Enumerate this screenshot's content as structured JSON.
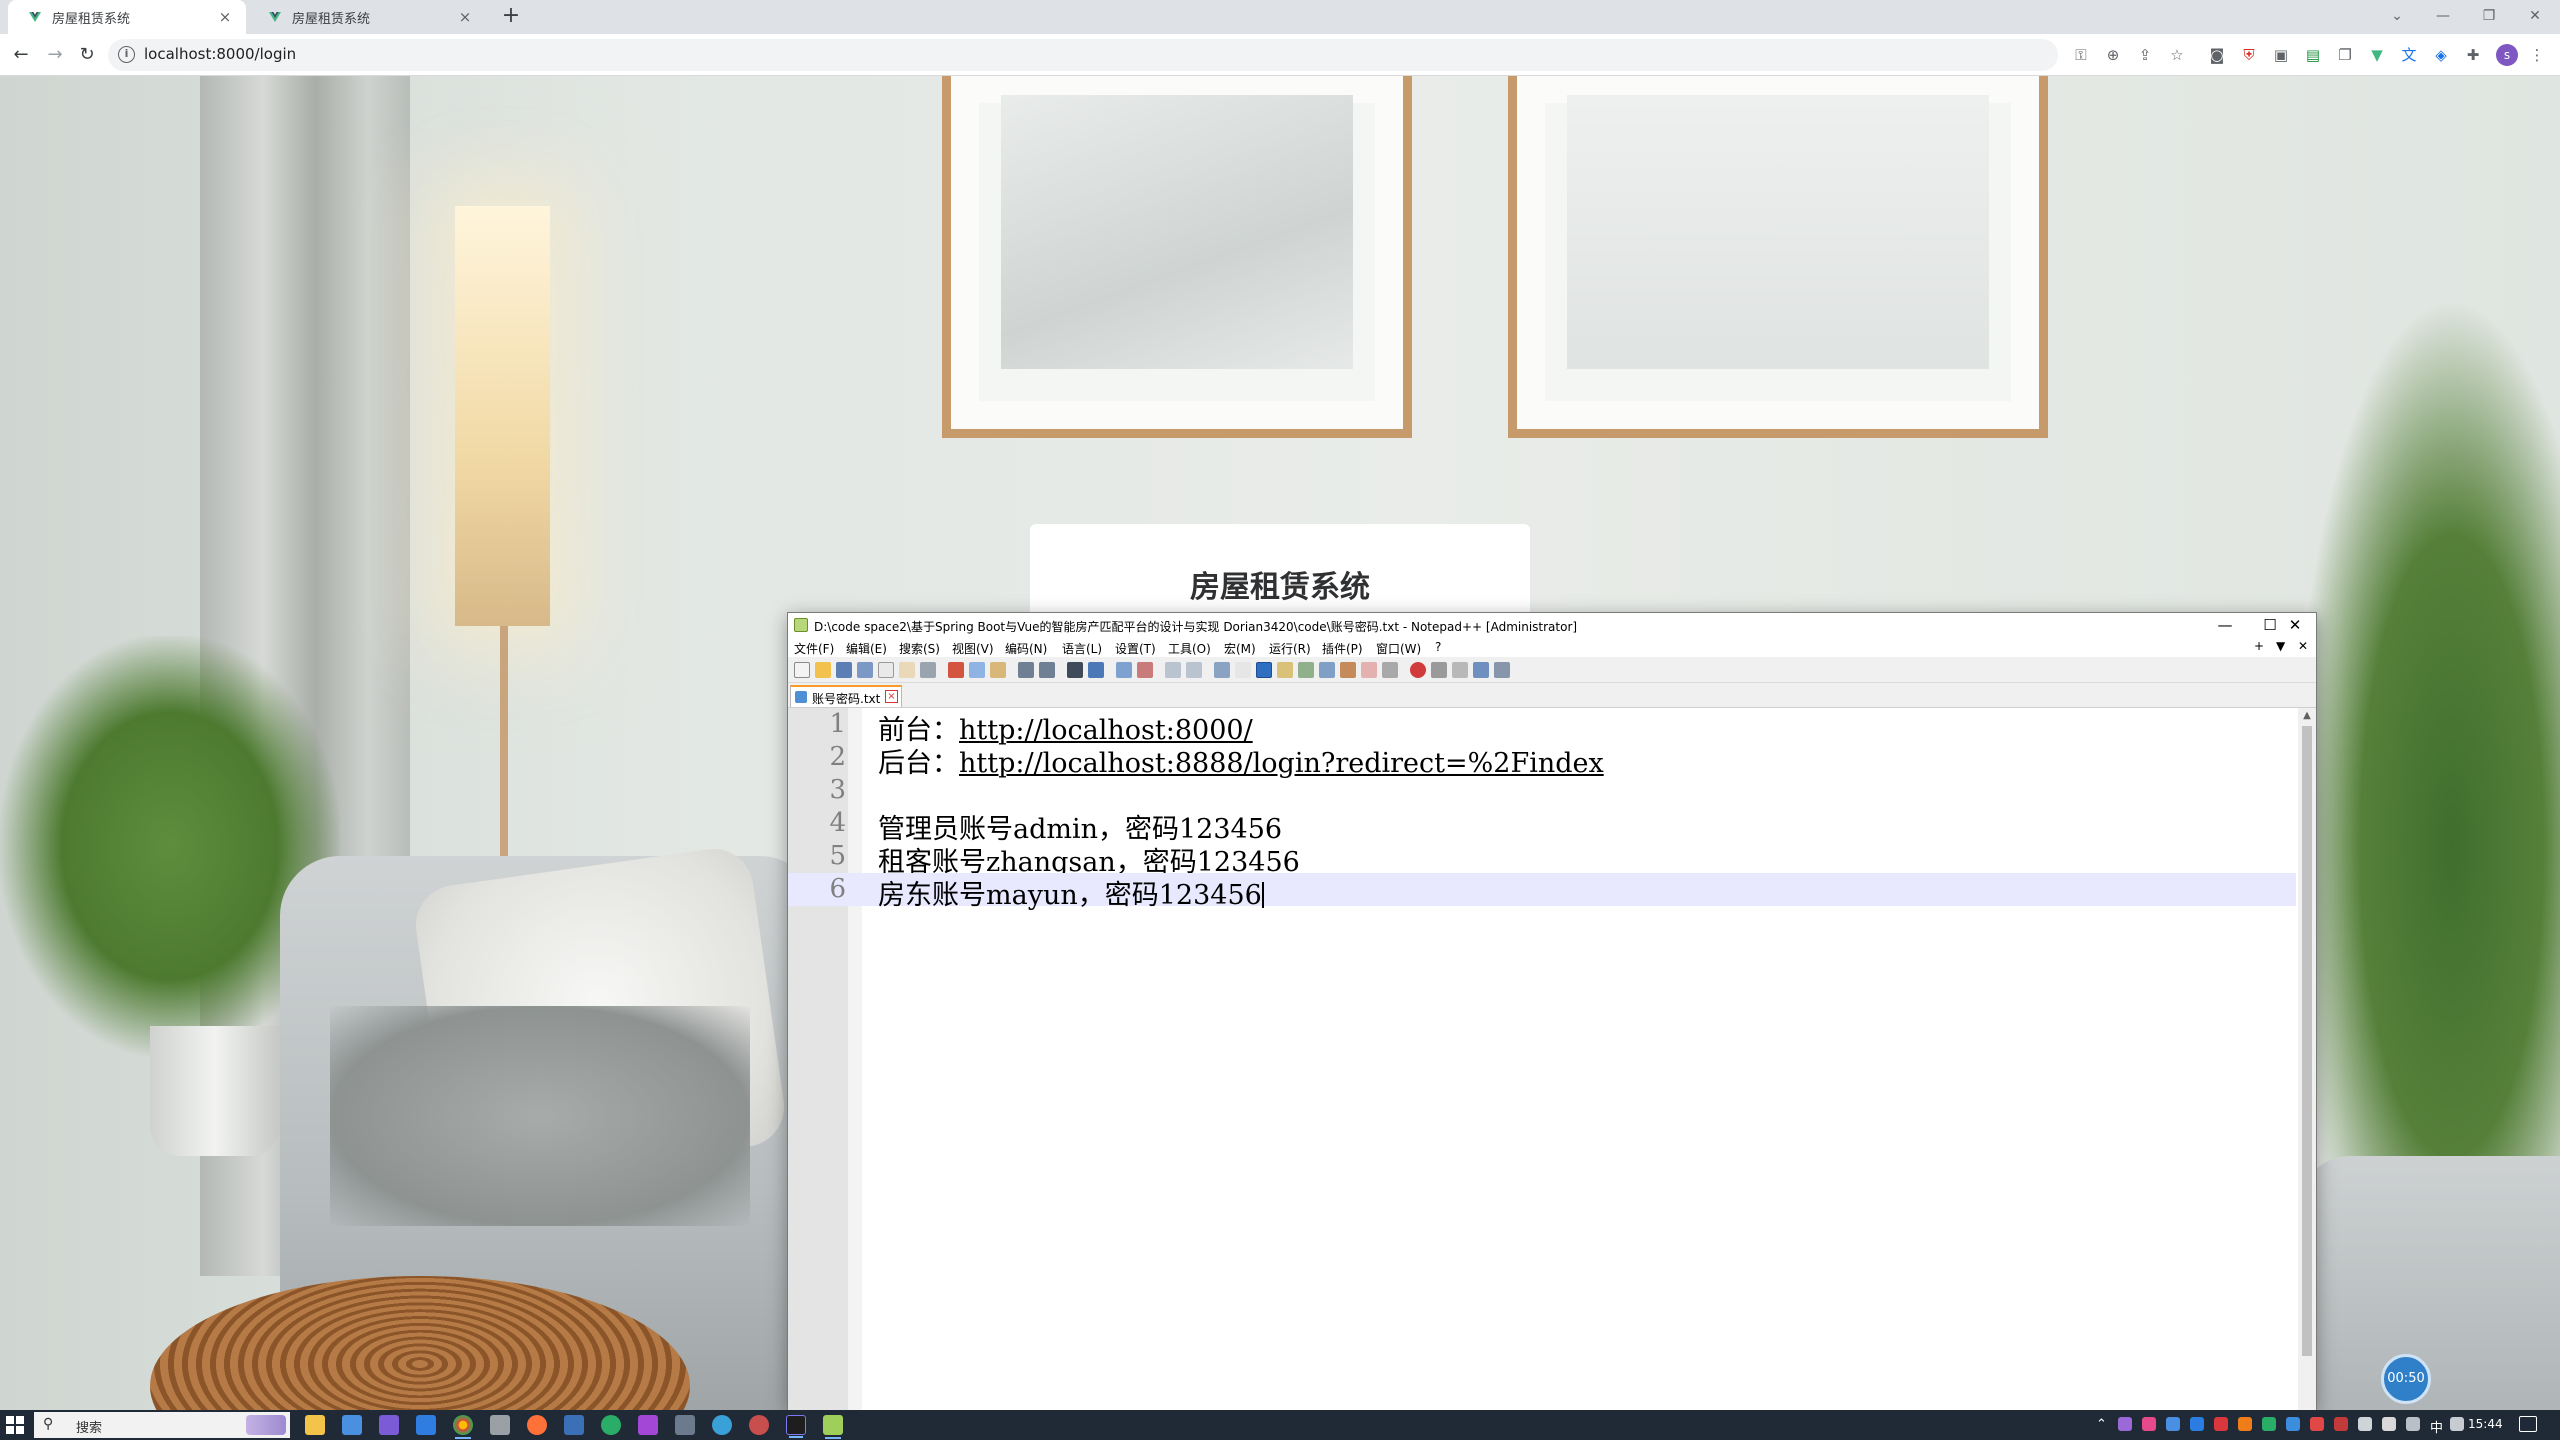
{
  "browser": {
    "tabs": [
      {
        "label": "房屋租赁系统",
        "close": "×"
      },
      {
        "label": "房屋租赁系统",
        "close": "×"
      }
    ],
    "new_tab": "+",
    "window_controls": {
      "chevron": "⌄",
      "minimize": "—",
      "restore": "❐",
      "close": "✕"
    },
    "nav": {
      "back": "←",
      "forward": "→",
      "reload": "↻"
    },
    "url": "localhost:8000/login",
    "info_icon_glyph": "i",
    "toolbar_icons": [
      "key-icon",
      "zoom-icon",
      "share-icon",
      "star-icon",
      "camera-icon",
      "shield-icon",
      "extension-icon",
      "clipboard-icon",
      "vue-devtools-icon",
      "translate-icon",
      "puzzle-icon",
      "download-icon",
      "sidepanel-icon"
    ],
    "profile_initial": "s",
    "menu_glyph": "⋮"
  },
  "page": {
    "login_title": "房屋租赁系统",
    "timer": "00:50"
  },
  "notepad": {
    "title": "D:\\code space2\\基于Spring Boot与Vue的智能房产匹配平台的设计与实现 Dorian3420\\code\\账号密码.txt - Notepad++ [Administrator]",
    "win": {
      "minimize": "—",
      "maximize": "☐",
      "close": "✕"
    },
    "menu": [
      "文件(F)",
      "编辑(E)",
      "搜索(S)",
      "视图(V)",
      "编码(N)",
      "语言(L)",
      "设置(T)",
      "工具(O)",
      "宏(M)",
      "运行(R)",
      "插件(P)",
      "窗口(W)",
      "?"
    ],
    "menu_right": [
      "+",
      "▼",
      "✕"
    ],
    "file_tab": {
      "name": "账号密码.txt",
      "close": "×"
    },
    "scroll_up": "▲",
    "lines": [
      {
        "num": "1",
        "prefix": "前台：",
        "link": "http://localhost:8000/"
      },
      {
        "num": "2",
        "prefix": "后台：",
        "link": "http://localhost:8888/login?redirect=%2Findex"
      },
      {
        "num": "3",
        "text": ""
      },
      {
        "num": "4",
        "text": "管理员账号admin，密码123456"
      },
      {
        "num": "5",
        "text": "租客账号zhangsan，密码123456"
      },
      {
        "num": "6",
        "text": "房东账号mayun，密码123456"
      }
    ]
  },
  "taskbar": {
    "search_icon": "⚲",
    "search_placeholder": "搜索",
    "ime": "中",
    "time": "15:44"
  },
  "colors": {
    "notepad_current_line": "#e8e8ff",
    "notepad_tab_accent": "#fa9a2a",
    "taskbar": "#1f2a36",
    "timer": "#2f80c9"
  }
}
